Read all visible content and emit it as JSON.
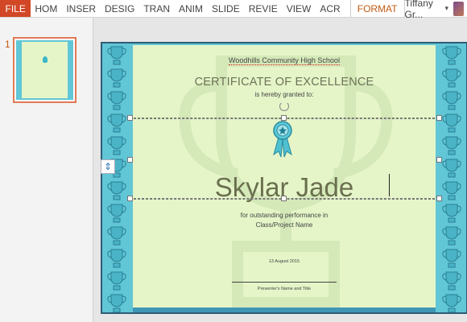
{
  "ribbon": {
    "file_label": "FILE",
    "tabs": [
      "HOM",
      "INSER",
      "DESIG",
      "TRAN",
      "ANIM",
      "SLIDE",
      "REVIE",
      "VIEW",
      "ACR"
    ],
    "format_label": "FORMAT",
    "user_name": "Tiffany Gr...",
    "caret": "▾"
  },
  "thumbnails": {
    "slide_number": "1"
  },
  "certificate": {
    "school": "Woodhills Community High School",
    "title": "CERTIFICATE OF EXCELLENCE",
    "granted": "is hereby granted to:",
    "recipient": "Skylar Jade",
    "reason_line1": "for outstanding performance in",
    "reason_line2": "Class/Project Name",
    "date": "13 August 2015",
    "presenter": "Presenter's Name and Title"
  },
  "colors": {
    "file_tab": "#d24726",
    "border_teal": "#61c6d6",
    "paper": "#e5f5c8",
    "accent": "#c55a11"
  }
}
